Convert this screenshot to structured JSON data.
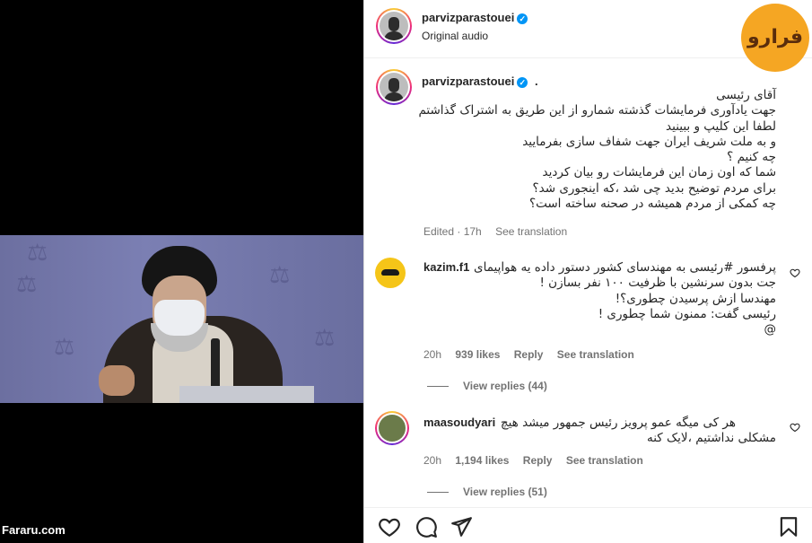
{
  "watermark": "Fararu.com",
  "logo_text": "فرارو",
  "post_header": {
    "username": "parvizparastouei",
    "verified": true,
    "subtitle": "Original audio"
  },
  "caption": {
    "username": "parvizparastouei",
    "separator": ".",
    "lines": [
      "آقای رئیسی",
      "جهت یادآوری فرمایشات گذشته شمارو از این طریق به اشتراک گذاشتم",
      "لطفا این کلیپ و ببینید",
      "و به ملت شریف ایران جهت شفاف سازی بفرمایید",
      "چه کنیم ؟",
      "شما که اون زمان این فرمایشات رو بیان کردید",
      "برای مردم توضیح بدید چی شد ،که اینجوری شد؟",
      "چه کمکی از مردم همیشه در صحنه ساخته است؟"
    ],
    "edited": "Edited · 17h",
    "see_translation": "See translation"
  },
  "comments": [
    {
      "username": "kazim.f1",
      "lines": [
        "پرفسور #رئیسی به مهندسای کشور دستور داده یه هواپیمای",
        "جت بدون سرنشین با ظرفیت ۱۰۰ نفر بسازن !",
        "مهندسا ازش پرسیدن چطوری؟!",
        "رئیسی گفت: ممنون شما چطوری !",
        "@"
      ],
      "time": "20h",
      "likes": "939 likes",
      "reply": "Reply",
      "see_translation": "See translation",
      "view_replies": "View replies (44)"
    },
    {
      "username": "maasoudyari",
      "lines": [
        "هر کی میگه عمو پرویز رئیس جمهور میشد هیچ",
        "مشکلی نداشتیم ،لایک کنه"
      ],
      "time": "20h",
      "likes": "1,194 likes",
      "reply": "Reply",
      "see_translation": "See translation",
      "view_replies": "View replies (51)"
    }
  ],
  "actions": {
    "like_icon": "heart-icon",
    "comment_icon": "comment-icon",
    "share_icon": "paper-plane-icon",
    "save_icon": "bookmark-icon"
  },
  "colors": {
    "verified": "#0095f6",
    "secondary_text": "#737373",
    "logo_bg": "#f5a623"
  }
}
